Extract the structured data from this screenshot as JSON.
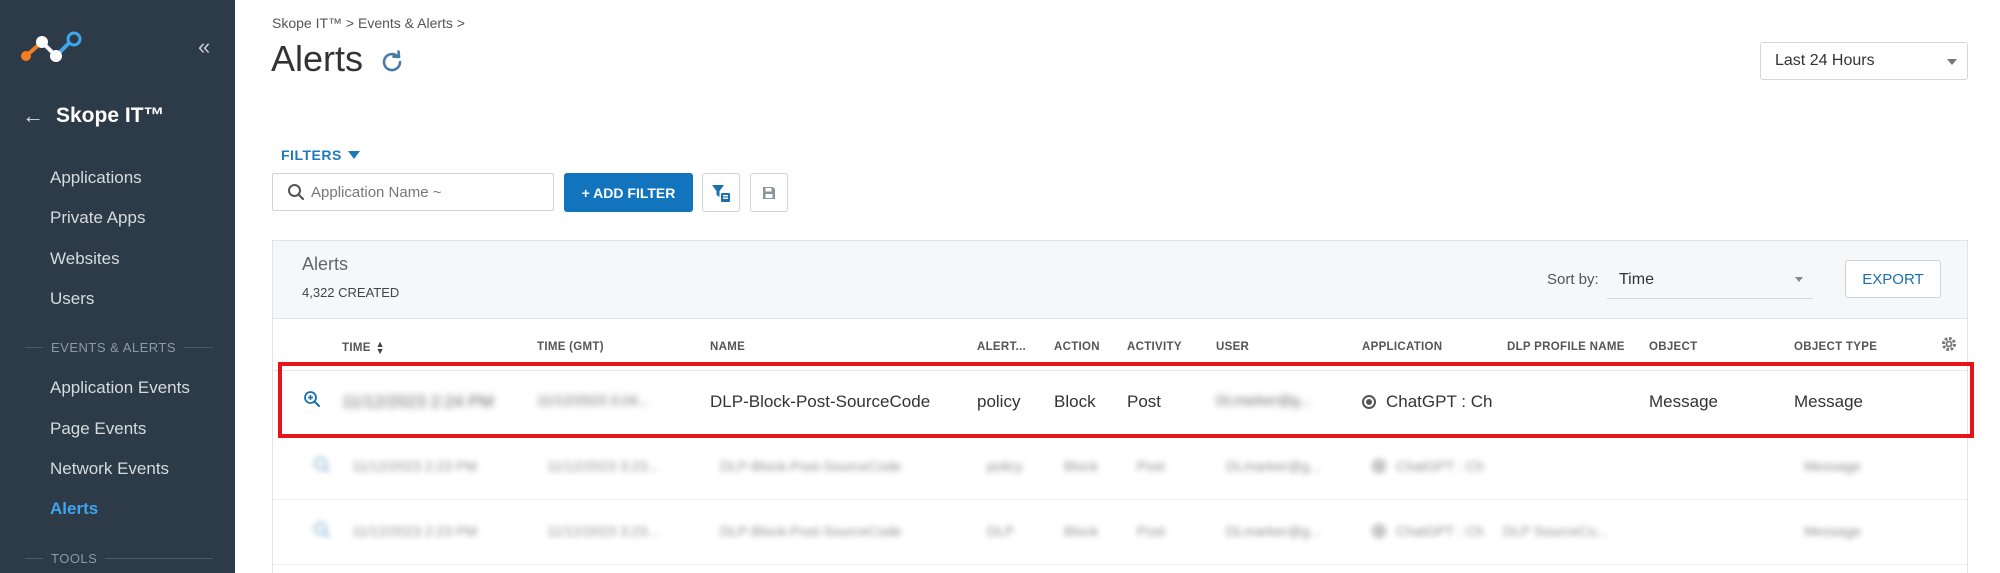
{
  "sidebar": {
    "product": "Skope IT™",
    "nav": {
      "applications": "Applications",
      "private_apps": "Private Apps",
      "websites": "Websites",
      "users": "Users",
      "events_section": "EVENTS & ALERTS",
      "application_events": "Application Events",
      "page_events": "Page Events",
      "network_events": "Network Events",
      "alerts": "Alerts",
      "tools_section": "TOOLS"
    },
    "collapse_icon": "double-chevron-left",
    "back_icon": "arrow-left"
  },
  "header": {
    "breadcrumb": "Skope IT™ > Events & Alerts >",
    "title": "Alerts",
    "time_range": "Last 24 Hours"
  },
  "filters": {
    "toggle_label": "FILTERS",
    "search_placeholder": "Application Name ~",
    "add_filter_label": "+ ADD FILTER"
  },
  "panel": {
    "title": "Alerts",
    "count": "4,322 CREATED",
    "sort_label": "Sort by:",
    "sort_value": "Time",
    "export_label": "EXPORT",
    "columns": [
      "TIME",
      "TIME (GMT)",
      "NAME",
      "ALERT...",
      "ACTION",
      "ACTIVITY",
      "USER",
      "APPLICATION",
      "DLP PROFILE NAME",
      "OBJECT",
      "OBJECT TYPE"
    ],
    "rows": [
      {
        "time": "11/12/2023 2:24 PM",
        "time_gmt": "11/12/2023 3:24...",
        "name": "DLP-Block-Post-SourceCode",
        "alert_type": "policy",
        "action": "Block",
        "activity": "Post",
        "user": "DLmarker@g...",
        "application": "ChatGPT : Ch",
        "dlp_profile": "",
        "object": "Message",
        "object_type": "Message"
      },
      {
        "time": "11/12/2023 2:23 PM",
        "time_gmt": "11/12/2023 3:23...",
        "name": "DLP-Block-Post-SourceCode",
        "alert_type": "policy",
        "action": "Block",
        "activity": "Post",
        "user": "DLmarker@g...",
        "application": "ChatGPT : Ch",
        "dlp_profile": "",
        "object": "",
        "object_type": "Message"
      },
      {
        "time": "11/12/2023 2:23 PM",
        "time_gmt": "11/12/2023 3:23...",
        "name": "DLP-Block-Post-SourceCode",
        "alert_type": "DLP",
        "action": "Block",
        "activity": "Post",
        "user": "DLmarker@g...",
        "application": "ChatGPT : Ch",
        "dlp_profile": "DLP SourceCo...",
        "object": "",
        "object_type": "Message"
      }
    ]
  },
  "colors": {
    "sidebar_bg": "#2d3a47",
    "accent": "#1274bd",
    "active_nav": "#3fa6ee",
    "highlight": "#e8141b"
  }
}
